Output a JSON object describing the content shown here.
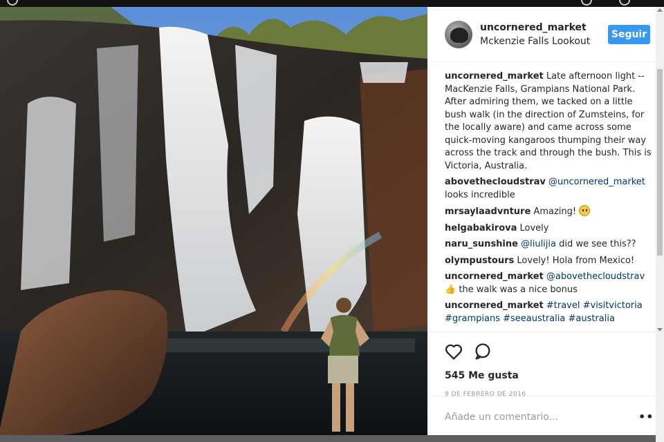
{
  "post": {
    "username": "uncornered_market",
    "location": "Mckenzie Falls Lookout",
    "follow_label": "Seguir",
    "likes": "545 Me gusta",
    "date": "9 DE FEBRERO DE 2016",
    "comment_placeholder": "Añade un comentario...",
    "more_label": "•••"
  },
  "comments": [
    {
      "user": "uncornered_market",
      "text": "Late afternoon light -- MacKenzie Falls, Grampians National Park. After admiring them, we tacked on a little bush walk (in the direction of Zumsteins, for the locally aware) and came across some quick-moving kangaroos thumping their way across the track and through the bush. This is Victoria, Australia."
    },
    {
      "user": "abovethecloudstrav",
      "mention": "@uncornered_market",
      "text": "looks incredible"
    },
    {
      "user": "mrsaylaadvnture",
      "text": "Amazing!"
    },
    {
      "user": "helgabakirova",
      "text": "Lovely"
    },
    {
      "user": "naru_sunshine",
      "mention": "@liulijia",
      "text": "did we see this??"
    },
    {
      "user": "olympustours",
      "text": "Lovely! Hola from Mexico!"
    },
    {
      "user": "uncornered_market",
      "mention": "@abovethecloudstrav",
      "text": "the walk was a nice bonus"
    },
    {
      "user": "uncornered_market",
      "tags": "#travel #visitvictoria #grampians #seeaustralia #australia"
    }
  ],
  "colors": {
    "accent": "#3897f0",
    "text": "#262626",
    "link": "#003569",
    "muted": "#999999"
  }
}
